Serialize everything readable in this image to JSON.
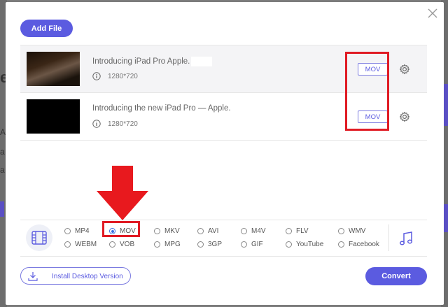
{
  "toolbar": {
    "add_file_label": "Add File"
  },
  "files": [
    {
      "title": "Introducing iPad Pro Apple.",
      "resolution": "1280*720",
      "format": "MOV"
    },
    {
      "title": "Introducing the new iPad Pro — Apple.",
      "resolution": "1280*720",
      "format": "MOV"
    }
  ],
  "formats": {
    "row1": [
      "MP4",
      "MOV",
      "MKV",
      "AVI",
      "M4V",
      "FLV",
      "WMV"
    ],
    "row2": [
      "WEBM",
      "VOB",
      "MPG",
      "3GP",
      "GIF",
      "YouTube",
      "Facebook"
    ],
    "selected": "MOV"
  },
  "footer": {
    "install_label": "Install Desktop Version",
    "convert_label": "Convert"
  },
  "colors": {
    "accent": "#5b5be0",
    "highlight": "#e01b24"
  },
  "backdrop": {
    "letters": [
      "e",
      "A",
      "a",
      "a"
    ]
  }
}
